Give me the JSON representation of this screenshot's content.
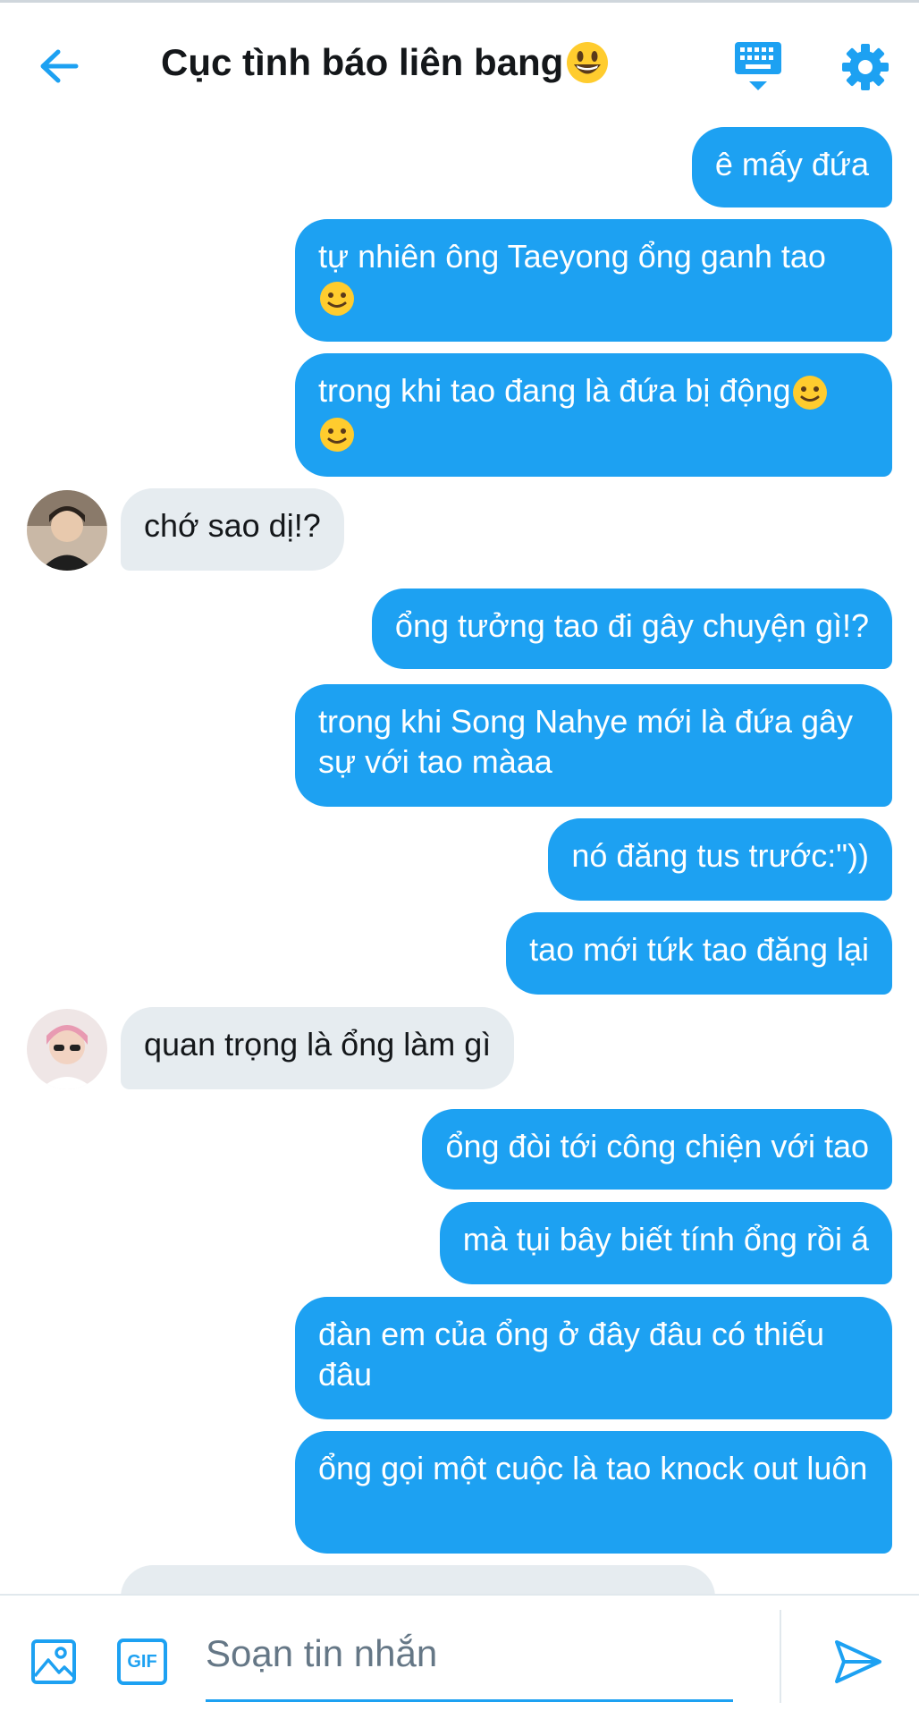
{
  "header": {
    "title": "Cục tình báo liên bang",
    "title_emoji": "grinning-face-emoji"
  },
  "messages": [
    {
      "side": "out",
      "text": "ê mấy đứa"
    },
    {
      "side": "out",
      "text": "tự nhiên ông Taeyong ổng ganh tao"
    },
    {
      "side": "out",
      "text": "trong khi tao đang là đứa bị động"
    },
    {
      "side": "in",
      "text": "chớ sao dị!?"
    },
    {
      "side": "out",
      "text": "ổng tưởng tao đi gây chuyện gì!?"
    },
    {
      "side": "out",
      "text": "trong khi Song Nahye mới là đứa gây sự với tao màaa"
    },
    {
      "side": "out",
      "text": "nó đăng tus trước:\"))"
    },
    {
      "side": "out",
      "text": "tao mới tứk tao đăng lại"
    },
    {
      "side": "in",
      "text": "quan trọng là ổng làm gì"
    },
    {
      "side": "out",
      "text": "ổng đòi tới công chiện với tao"
    },
    {
      "side": "out",
      "text": "mà tụi bây biết tính ổng rồi á"
    },
    {
      "side": "out",
      "text": "đàn em của ổng ở đây đâu có thiếu đâu"
    },
    {
      "side": "out",
      "text": "ổng gọi một cuộc là tao knock out luôn"
    }
  ],
  "compose": {
    "placeholder": "Soạn tin nhắn",
    "value": "",
    "gif_label": "GIF"
  },
  "colors": {
    "accent": "#1da1f2",
    "incoming_bubble": "#e6ecf0",
    "text": "#14171a"
  }
}
